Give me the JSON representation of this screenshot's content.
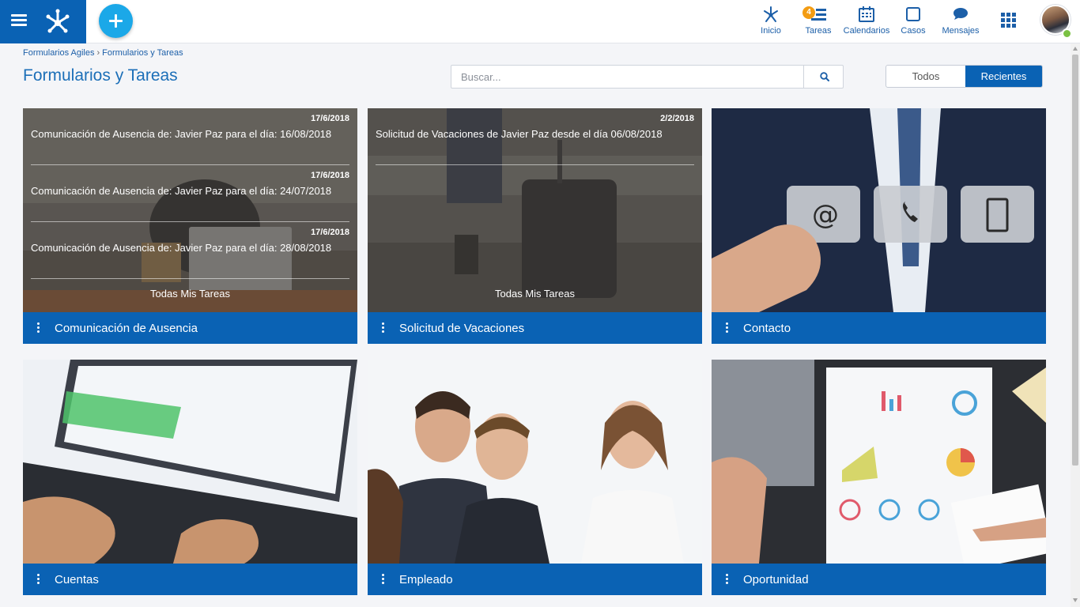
{
  "colors": {
    "brand_blue": "#0a62b4",
    "accent_cyan": "#1ba8e8",
    "badge_orange": "#f39c12",
    "status_green": "#7ac143"
  },
  "topbar": {
    "menu_icon": "hamburger-icon",
    "logo_icon": "network-logo-icon",
    "add_icon": "plus-icon",
    "nav": [
      {
        "label": "Inicio",
        "icon": "network-icon"
      },
      {
        "label": "Tareas",
        "icon": "tasks-icon",
        "badge": "4"
      },
      {
        "label": "Calendarios",
        "icon": "calendar-icon"
      },
      {
        "label": "Casos",
        "icon": "square-icon"
      },
      {
        "label": "Mensajes",
        "icon": "chat-bubble-icon"
      }
    ],
    "apps_icon": "apps-grid-icon",
    "avatar_icon": "user-avatar"
  },
  "breadcrumb": {
    "items": [
      "Formularios Agiles",
      "Formularios y Tareas"
    ],
    "separator": "›"
  },
  "page": {
    "title": "Formularios y Tareas"
  },
  "search": {
    "placeholder": "Buscar...",
    "value": "",
    "icon": "search-icon"
  },
  "toggle": {
    "options": [
      "Todos",
      "Recientes"
    ],
    "selected": "Recientes"
  },
  "cards": [
    {
      "title": "Comunicación de Ausencia",
      "tasks": [
        {
          "date": "17/6/2018",
          "text": "Comunicación de Ausencia de: Javier Paz para el día: 16/08/2018"
        },
        {
          "date": "17/6/2018",
          "text": "Comunicación de Ausencia de: Javier Paz para el día: 24/07/2018"
        },
        {
          "date": "17/6/2018",
          "text": "Comunicación de Ausencia de: Javier Paz para el día: 28/08/2018"
        }
      ],
      "all_tasks_label": "Todas Mis Tareas"
    },
    {
      "title": "Solicitud de Vacaciones",
      "tasks": [
        {
          "date": "2/2/2018",
          "text": "Solicitud de Vacaciones de Javier  Paz desde el día 06/08/2018"
        }
      ],
      "all_tasks_label": "Todas Mis Tareas"
    },
    {
      "title": "Contacto",
      "image_icons": [
        "at-sign-icon",
        "phone-icon",
        "tablet-icon"
      ],
      "image_labels": [
        "@"
      ]
    },
    {
      "title": "Cuentas"
    },
    {
      "title": "Empleado"
    },
    {
      "title": "Oportunidad"
    }
  ]
}
